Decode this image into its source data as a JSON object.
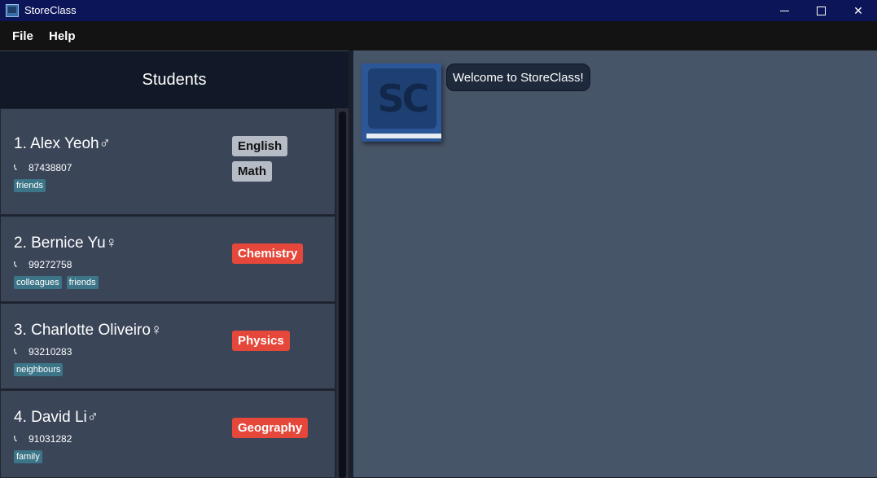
{
  "window": {
    "title": "StoreClass"
  },
  "menu": {
    "file": "File",
    "help": "Help"
  },
  "panel": {
    "header": "Students"
  },
  "students": [
    {
      "name": "1. Alex Yeoh♂",
      "phone": "87438807",
      "tags": [
        "friends"
      ],
      "subjects": [
        "English",
        "Math"
      ]
    },
    {
      "name": "2. Bernice Yu♀",
      "phone": "99272758",
      "tags": [
        "colleagues",
        "friends"
      ],
      "subjects": [
        "Chemistry"
      ]
    },
    {
      "name": "3. Charlotte Oliveiro♀",
      "phone": "93210283",
      "tags": [
        "neighbours"
      ],
      "subjects": [
        "Physics"
      ]
    },
    {
      "name": "4. David Li♂",
      "phone": "91031282",
      "tags": [
        "family"
      ],
      "subjects": [
        "Geography"
      ]
    }
  ],
  "logo": {
    "text": "SC"
  },
  "chat": {
    "message": "Welcome to StoreClass!"
  },
  "colors": {
    "titlebar": "#0c1557",
    "subject_grey": "#b6bcc6",
    "subject_red": "#e5473a",
    "tag": "#3c7588"
  }
}
